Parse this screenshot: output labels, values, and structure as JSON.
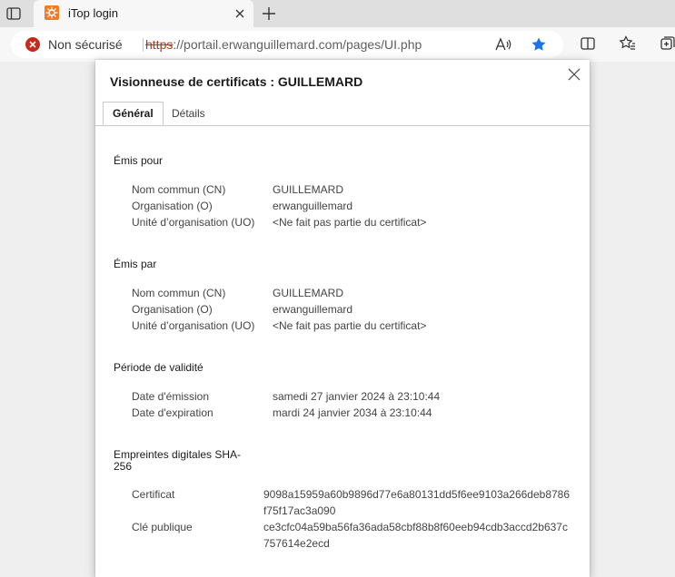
{
  "browser": {
    "tab": {
      "title": "iTop login"
    },
    "address_bar": {
      "security_label": "Non sécurisé",
      "url_scheme": "https",
      "url_rest": "://portail.erwanguillemard.com/pages/UI.php"
    },
    "colors": {
      "accent": "#1a73e8",
      "warning_red": "#c42b1c",
      "favicon_orange": "#f47920"
    }
  },
  "dialog": {
    "title": "Visionneuse de certificats : GUILLEMARD",
    "tabs": [
      {
        "label": "Général",
        "selected": true
      },
      {
        "label": "Détails",
        "selected": false
      }
    ],
    "issued_to": {
      "heading": "Émis pour",
      "rows": [
        {
          "label": "Nom commun (CN)",
          "value": "GUILLEMARD"
        },
        {
          "label": "Organisation (O)",
          "value": "erwanguillemard"
        },
        {
          "label": "Unité d’organisation (UO)",
          "value": "<Ne fait pas partie du certificat>"
        }
      ]
    },
    "issued_by": {
      "heading": "Émis par",
      "rows": [
        {
          "label": "Nom commun (CN)",
          "value": "GUILLEMARD"
        },
        {
          "label": "Organisation (O)",
          "value": "erwanguillemard"
        },
        {
          "label": "Unité d’organisation (UO)",
          "value": "<Ne fait pas partie du certificat>"
        }
      ]
    },
    "validity": {
      "heading": "Période de validité",
      "rows": [
        {
          "label": "Date d'émission",
          "value": "samedi 27 janvier 2024 à 23:10:44"
        },
        {
          "label": "Date d'expiration",
          "value": "mardi 24 janvier 2034 à 23:10:44"
        }
      ]
    },
    "fingerprints": {
      "heading_line1": "Empreintes digitales SHA-",
      "heading_line2": "256",
      "rows": [
        {
          "label": "Certificat",
          "value": "9098a15959a60b9896d77e6a80131dd5f6ee9103a266deb8786f75f17ac3a090"
        },
        {
          "label": "Clé publique",
          "value": "ce3cfc04a59ba56fa36ada58cbf88b8f60eeb94cdb3accd2b637c757614e2ecd"
        }
      ]
    }
  }
}
